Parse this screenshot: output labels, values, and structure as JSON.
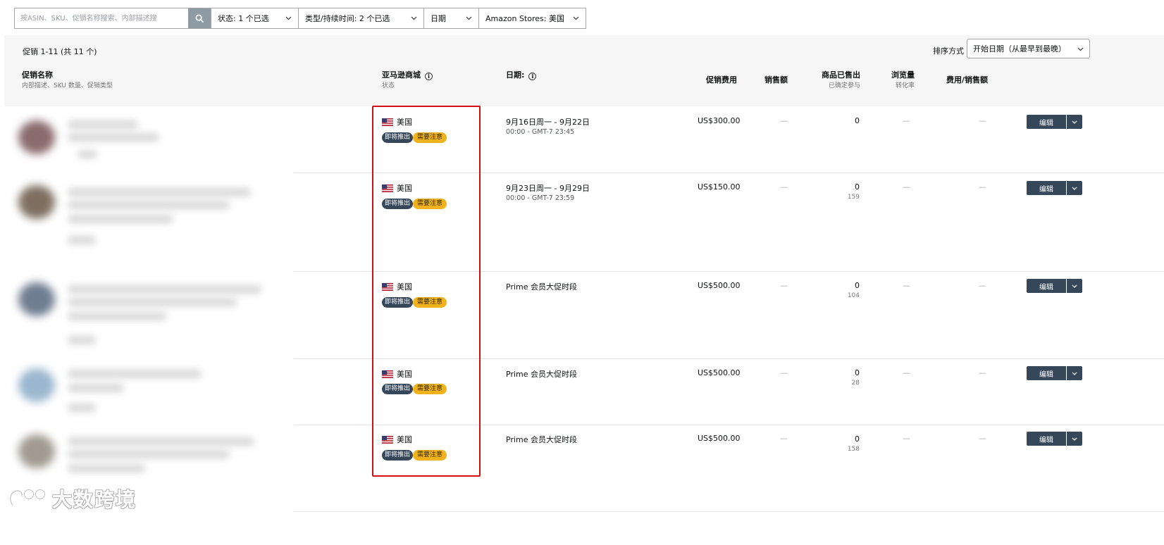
{
  "filters": {
    "search_placeholder": "按ASIN、SKU、促销名称搜索、内部描述搜",
    "status": "状态: 1 个已选",
    "type_duration": "类型/持续时间: 2 个已选",
    "date": "日期",
    "store": "Amazon Stores: 美国"
  },
  "list_header": {
    "count": "促销 1-11 (共 11 个)",
    "sort_label": "排序方式",
    "sort_value": "开始日期（从最早到最晚）"
  },
  "columns": {
    "name": "促销名称",
    "name_sub": "内部描述、SKU 数量、促销类型",
    "store": "亚马逊商城",
    "store_sub": "状态",
    "date": "日期:",
    "fee": "促销费用",
    "sales": "销售额",
    "units": "商品已售出",
    "units_sub": "已确定参与",
    "views": "浏览量",
    "views_sub": "转化率",
    "fee_ratio": "费用/销售额"
  },
  "rows": [
    {
      "store": "美国",
      "status": "即将推出",
      "note": "需要注意",
      "date": "9月16日周一 - 9月22日",
      "time": "00:00 - GMT-7 23:45",
      "fee": "US$300.00",
      "sales": "—",
      "units": "0",
      "units_sub": "",
      "views": "—",
      "ratio": "—",
      "edit": "编辑"
    },
    {
      "store": "美国",
      "status": "即将推出",
      "note": "需要注意",
      "date": "9月23日周一 - 9月29日",
      "time": "00:00 - GMT-7 23:59",
      "fee": "US$150.00",
      "sales": "—",
      "units": "0",
      "units_sub": "159",
      "views": "—",
      "ratio": "—",
      "edit": "编辑"
    },
    {
      "store": "美国",
      "status": "即将推出",
      "note": "需要注意",
      "date": "Prime 会员大促时段",
      "time": "",
      "fee": "US$500.00",
      "sales": "—",
      "units": "0",
      "units_sub": "104",
      "views": "—",
      "ratio": "—",
      "edit": "编辑"
    },
    {
      "store": "美国",
      "status": "即将推出",
      "note": "需要注意",
      "date": "Prime 会员大促时段",
      "time": "",
      "fee": "US$500.00",
      "sales": "—",
      "units": "0",
      "units_sub": "28",
      "views": "—",
      "ratio": "—",
      "edit": "编辑"
    },
    {
      "store": "美国",
      "status": "即将推出",
      "note": "需要注意",
      "date": "Prime 会员大促时段",
      "time": "",
      "fee": "US$500.00",
      "sales": "—",
      "units": "0",
      "units_sub": "158",
      "views": "—",
      "ratio": "—",
      "edit": "编辑"
    }
  ],
  "watermark": "大数跨境",
  "colors": {
    "dark_badge": "#37475a",
    "yellow_badge": "#f0b21d",
    "highlight": "#d40f14",
    "header_bg": "#f6f6f6"
  },
  "icons": [
    "search-icon",
    "chevron-down-icon",
    "info-icon",
    "us-flag-icon",
    "caret-down-icon"
  ]
}
